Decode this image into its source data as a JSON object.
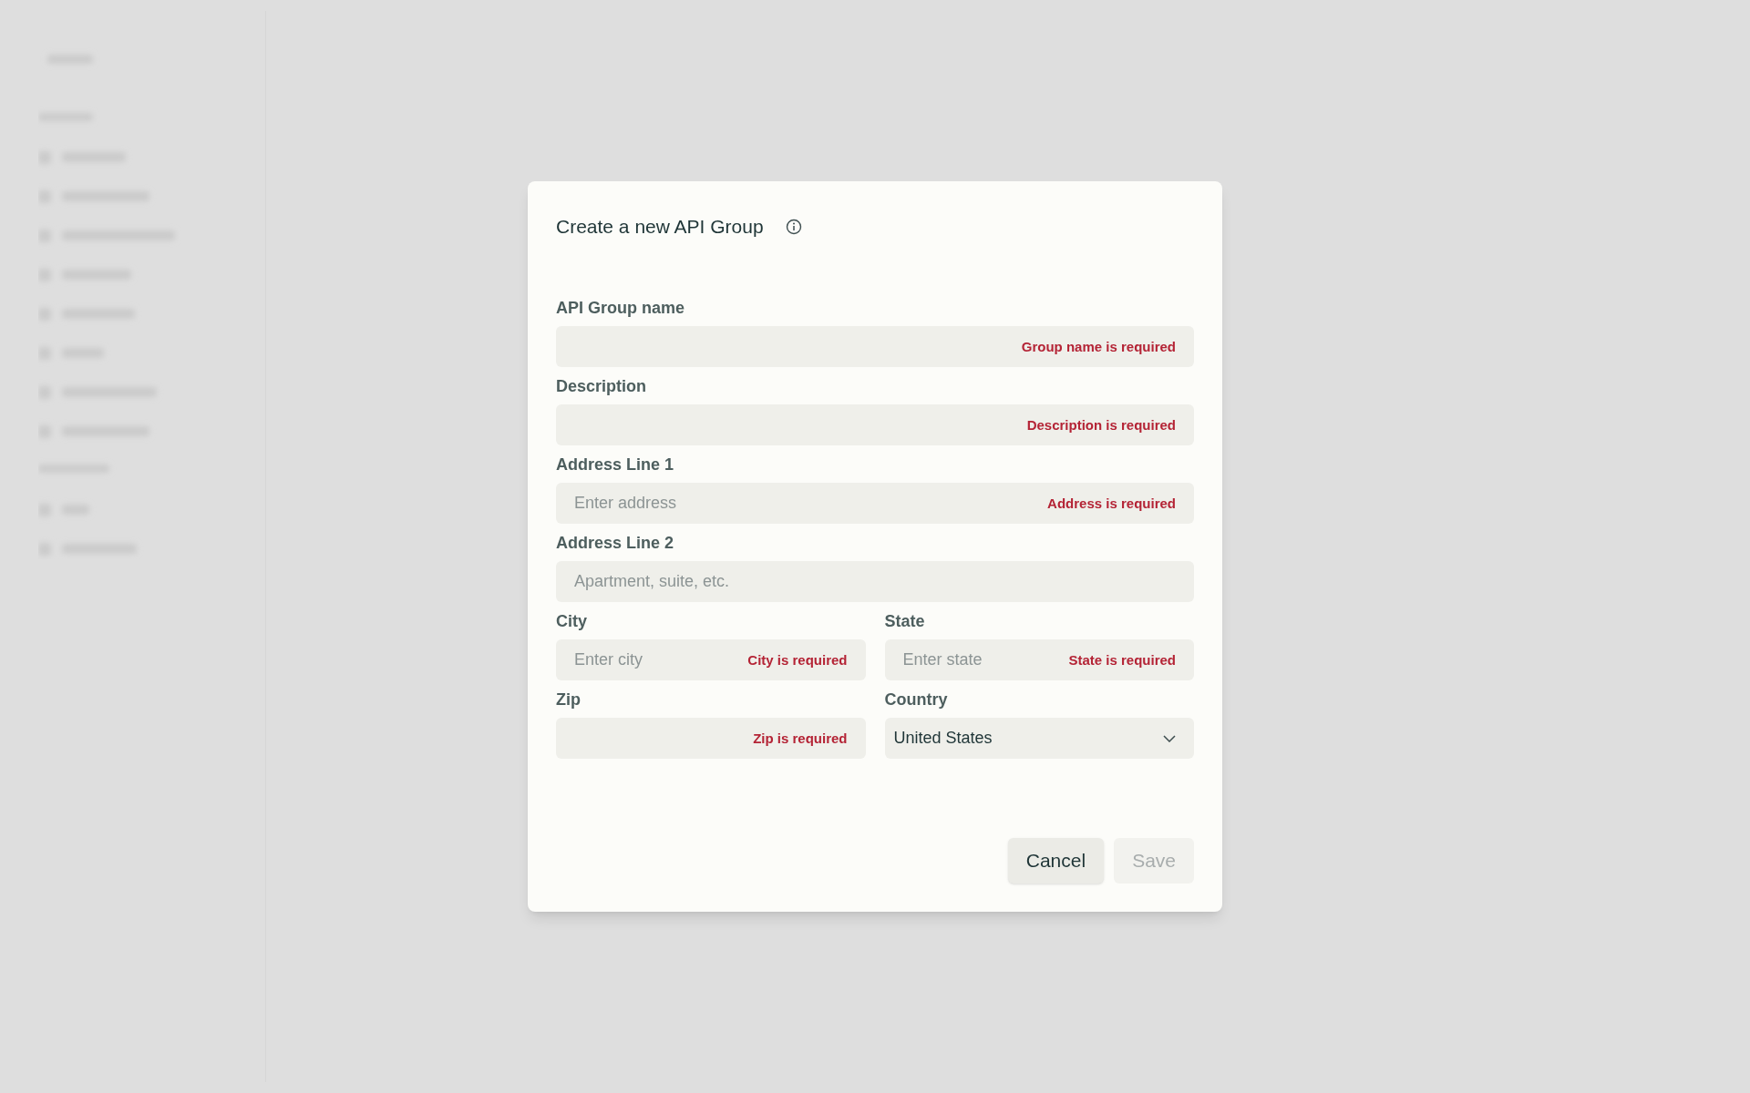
{
  "dialog": {
    "title": "Create a new API Group",
    "rows": [
      [
        {
          "label": "API Group name",
          "kind": "text",
          "error": "Group name is required"
        }
      ],
      [
        {
          "label": "Description",
          "kind": "text",
          "error": "Description is required"
        }
      ],
      [
        {
          "label": "Address Line 1",
          "kind": "text",
          "placeholder": "Enter address",
          "error": "Address is required"
        }
      ],
      [
        {
          "label": "Address Line 2",
          "kind": "text",
          "placeholder": "Apartment, suite, etc."
        }
      ],
      [
        {
          "label": "City",
          "kind": "text",
          "placeholder": "Enter city",
          "error": "City is required"
        },
        {
          "label": "State",
          "kind": "text",
          "placeholder": "Enter state",
          "error": "State is required"
        }
      ],
      [
        {
          "label": "Zip",
          "kind": "text",
          "error": "Zip is required"
        },
        {
          "label": "Country",
          "kind": "select",
          "value": "United States"
        }
      ]
    ],
    "buttons": [
      {
        "label": "Cancel",
        "disabled": false
      },
      {
        "label": "Save",
        "disabled": true
      }
    ]
  }
}
